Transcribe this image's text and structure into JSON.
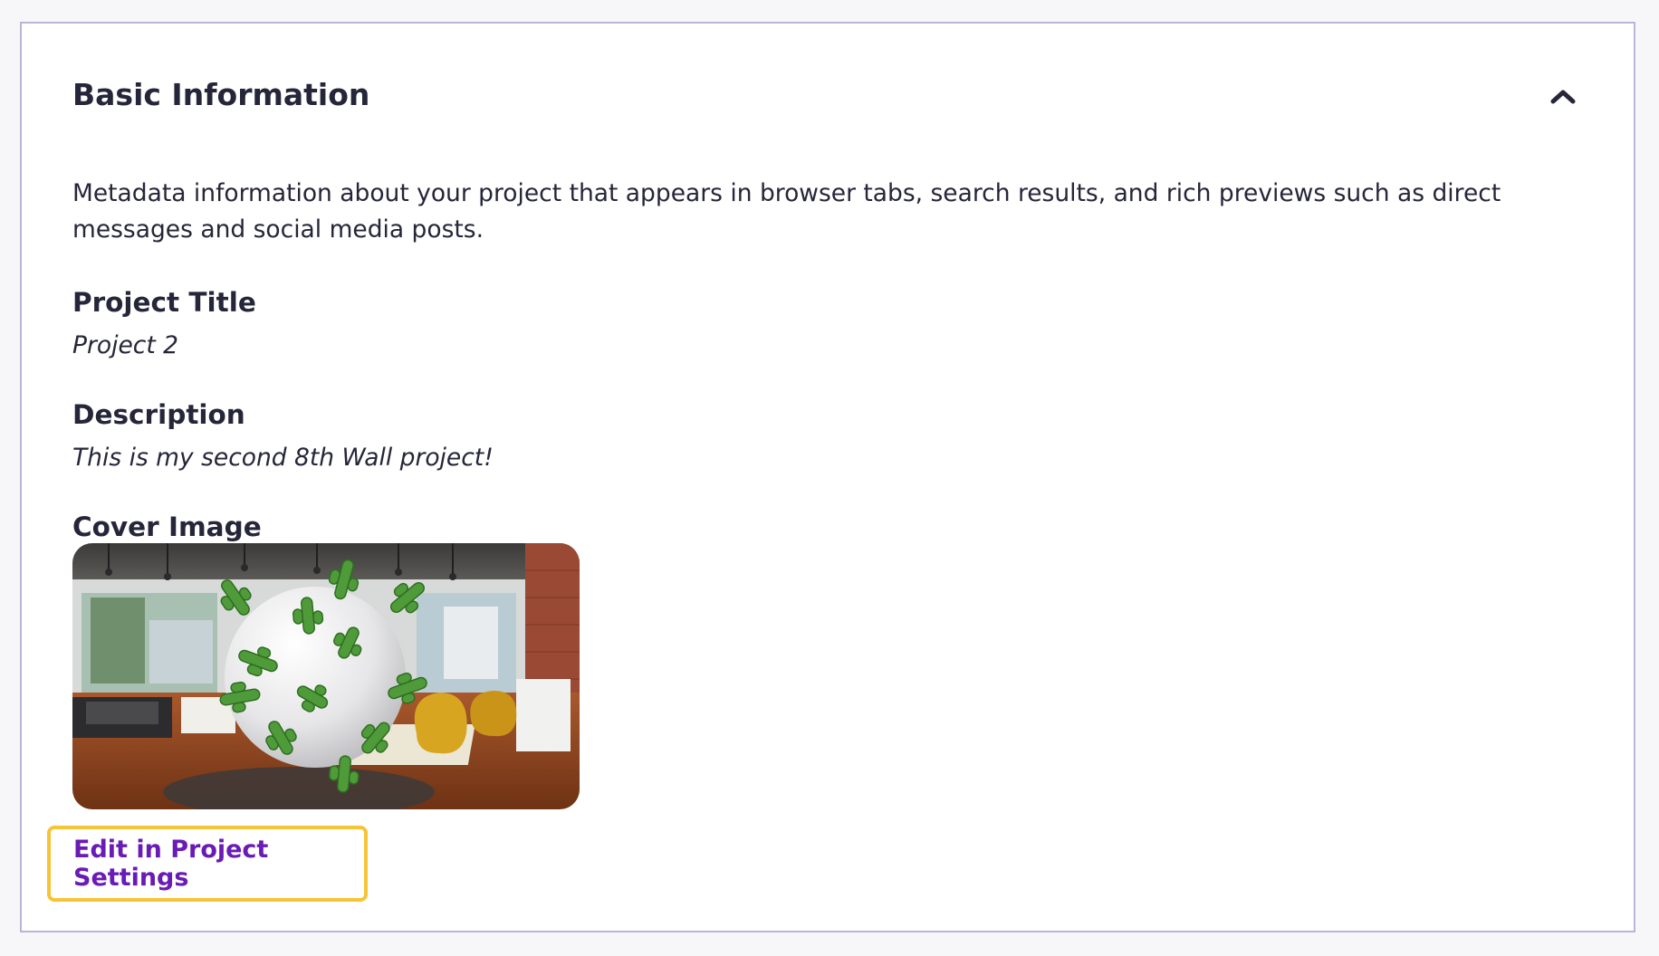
{
  "section": {
    "title": "Basic Information",
    "collapse_icon": "chevron-up-icon",
    "description": "Metadata information about your project that appears in browser tabs, search results, and rich previews such as direct messages and social media posts."
  },
  "fields": {
    "project_title": {
      "label": "Project Title",
      "value": "Project 2"
    },
    "description": {
      "label": "Description",
      "value": "This is my second 8th Wall project!"
    },
    "cover_image": {
      "label": "Cover Image",
      "alt": "Cover image of an office showroom with a white AR sphere surrounded by green cactus models"
    }
  },
  "actions": {
    "edit_label": "Edit in Project Settings"
  },
  "colors": {
    "background": "#f7f7fa",
    "panel_border": "#b9b5d8",
    "text": "#26263a",
    "link_purple": "#6a1bb5",
    "focus_ring": "#f6c435"
  }
}
